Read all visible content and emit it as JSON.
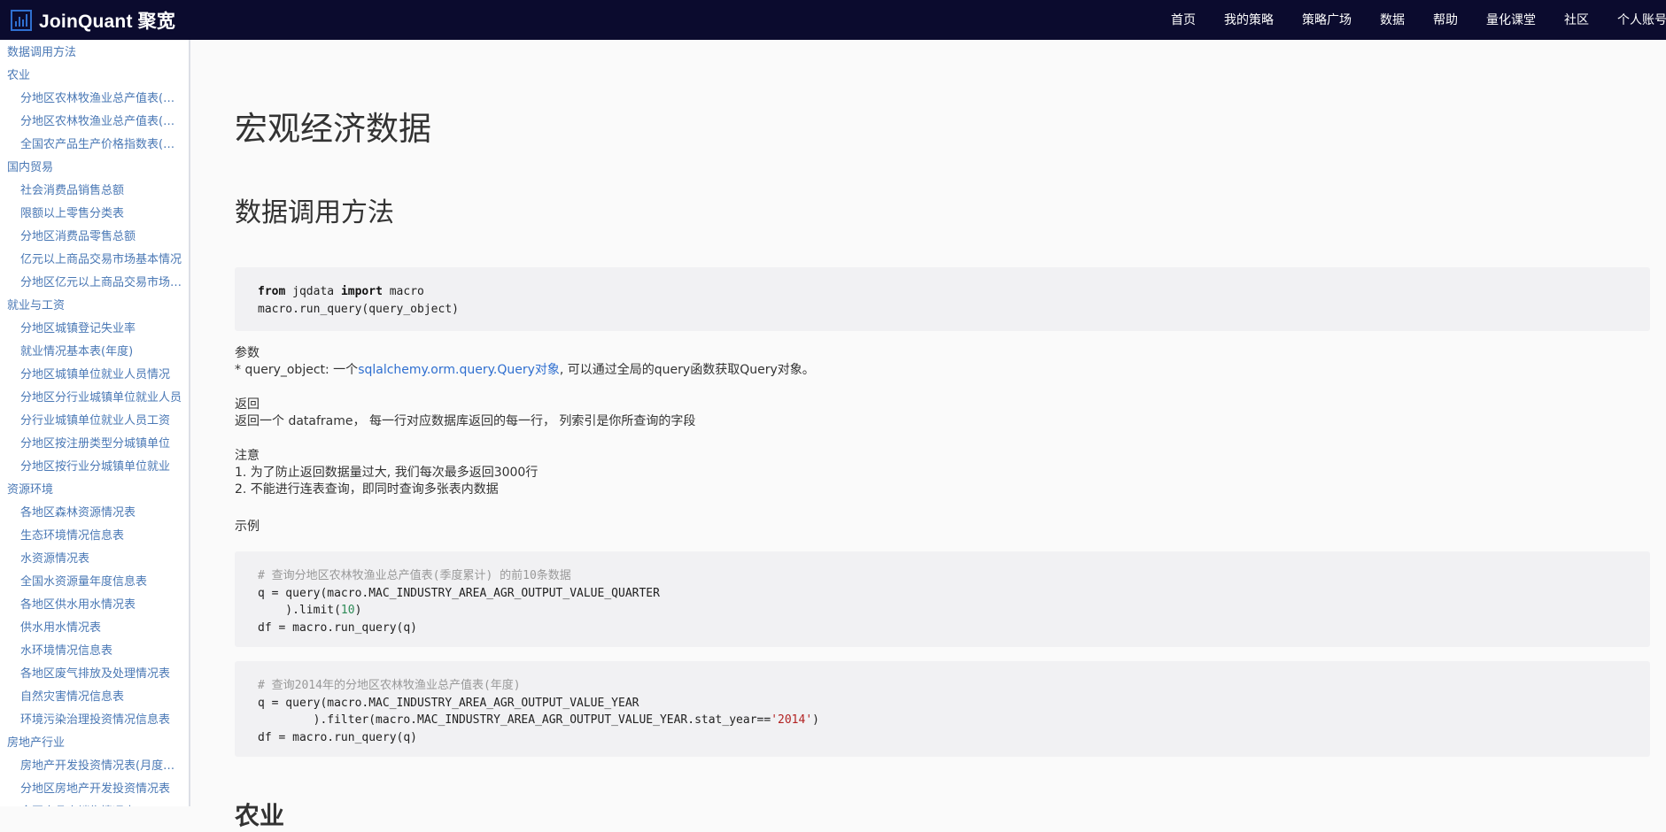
{
  "brand": {
    "logo_text": "JoinQuant 聚宽"
  },
  "nav": {
    "items": [
      "首页",
      "我的策略",
      "策略广场",
      "数据",
      "帮助",
      "量化课堂",
      "社区",
      "个人账号"
    ]
  },
  "sidebar": {
    "items": [
      {
        "label": "数据调用方法",
        "level": "cat"
      },
      {
        "label": "农业",
        "level": "cat"
      },
      {
        "label": "分地区农林牧渔业总产值表(季度累计)",
        "level": "sub"
      },
      {
        "label": "分地区农林牧渔业总产值表(年度)",
        "level": "sub"
      },
      {
        "label": "全国农产品生产价格指数表(季度)",
        "level": "sub"
      },
      {
        "label": "国内贸易",
        "level": "cat"
      },
      {
        "label": "社会消费品销售总额",
        "level": "sub"
      },
      {
        "label": "限额以上零售分类表",
        "level": "sub"
      },
      {
        "label": "分地区消费品零售总额",
        "level": "sub"
      },
      {
        "label": "亿元以上商品交易市场基本情况",
        "level": "sub"
      },
      {
        "label": "分地区亿元以上商品交易市场情况",
        "level": "sub"
      },
      {
        "label": "就业与工资",
        "level": "cat"
      },
      {
        "label": "分地区城镇登记失业率",
        "level": "sub"
      },
      {
        "label": "就业情况基本表(年度)",
        "level": "sub"
      },
      {
        "label": "分地区城镇单位就业人员情况",
        "level": "sub"
      },
      {
        "label": "分地区分行业城镇单位就业人员",
        "level": "sub"
      },
      {
        "label": "分行业城镇单位就业人员工资",
        "level": "sub"
      },
      {
        "label": "分地区按注册类型分城镇单位",
        "level": "sub"
      },
      {
        "label": "分地区按行业分城镇单位就业",
        "level": "sub"
      },
      {
        "label": "资源环境",
        "level": "cat"
      },
      {
        "label": "各地区森林资源情况表",
        "level": "sub"
      },
      {
        "label": "生态环境情况信息表",
        "level": "sub"
      },
      {
        "label": "水资源情况表",
        "level": "sub"
      },
      {
        "label": "全国水资源量年度信息表",
        "level": "sub"
      },
      {
        "label": "各地区供水用水情况表",
        "level": "sub"
      },
      {
        "label": "供水用水情况表",
        "level": "sub"
      },
      {
        "label": "水环境情况信息表",
        "level": "sub"
      },
      {
        "label": "各地区废气排放及处理情况表",
        "level": "sub"
      },
      {
        "label": "自然灾害情况信息表",
        "level": "sub"
      },
      {
        "label": "环境污染治理投资情况信息表",
        "level": "sub"
      },
      {
        "label": "房地产行业",
        "level": "cat"
      },
      {
        "label": "房地产开发投资情况表(月度累计)",
        "level": "sub"
      },
      {
        "label": "分地区房地产开发投资情况表",
        "level": "sub"
      },
      {
        "label": "全国商品房销售情况表",
        "level": "sub"
      }
    ]
  },
  "main": {
    "title": "宏观经济数据",
    "section_title": "数据调用方法",
    "code1": {
      "kw_from": "from",
      "module": " jqdata ",
      "kw_import": "import",
      "name": " macro",
      "line2": "macro.run_query(query_object)"
    },
    "params": {
      "label": "参数",
      "prefix": "* query_object: 一个",
      "link": "sqlalchemy.orm.query.Query对象",
      "suffix": ", 可以通过全局的query函数获取Query对象。"
    },
    "returns": {
      "label": "返回",
      "text": "返回一个 dataframe， 每一行对应数据库返回的每一行， 列索引是你所查询的字段"
    },
    "notes": {
      "label": "注意",
      "line1": "1. 为了防止返回数据量过大, 我们每次最多返回3000行",
      "line2": "2. 不能进行连表查询，即同时查询多张表内数据"
    },
    "example_label": "示例",
    "code2": {
      "comment": "# 查询分地区农林牧渔业总产值表(季度累计) 的前10条数据",
      "line2": "q = query(macro.MAC_INDUSTRY_AREA_AGR_OUTPUT_VALUE_QUARTER",
      "line3_pre": "    ).limit(",
      "line3_num": "10",
      "line3_post": ")",
      "line4": "df = macro.run_query(q)"
    },
    "code3": {
      "comment": "# 查询2014年的分地区农林牧渔业总产值表(年度)",
      "line2": "q = query(macro.MAC_INDUSTRY_AREA_AGR_OUTPUT_VALUE_YEAR",
      "line3_pre": "        ).filter(macro.MAC_INDUSTRY_AREA_AGR_OUTPUT_VALUE_YEAR.stat_year==",
      "line3_str": "'2014'",
      "line3_post": ")",
      "line4": "df = macro.run_query(q)"
    },
    "next_heading": "农业"
  },
  "colors": {
    "topbar_bg": "#0b0b2e",
    "sidebar_link": "#4a78b5",
    "link": "#2f6fd0",
    "code_bg": "#f1f1f3"
  }
}
